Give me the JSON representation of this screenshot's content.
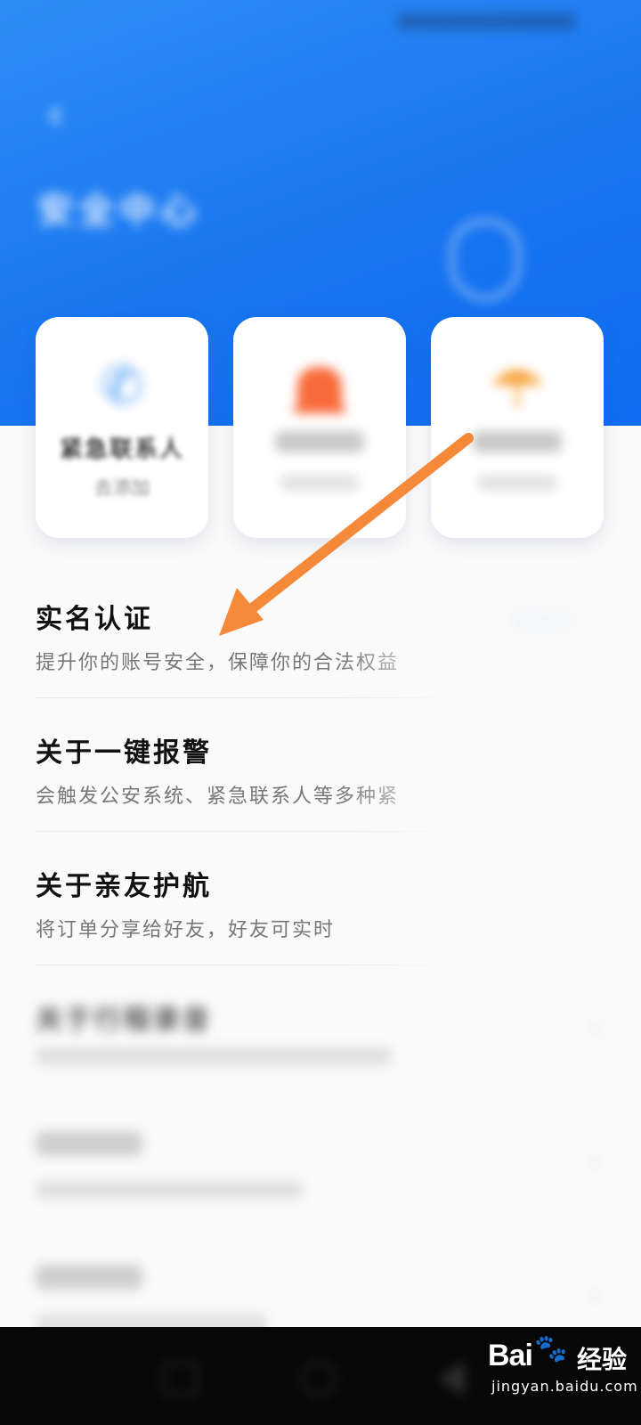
{
  "app": {
    "header": {
      "title": "安全中心",
      "subtitle": ""
    },
    "colors": {
      "header_blue": "#1976f0",
      "arrow_orange": "#f5893a",
      "card_bg": "#ffffff"
    },
    "quick_cards": [
      {
        "title": "紧急联系人",
        "subtitle": "去添加",
        "icon": "phone-icon"
      },
      {
        "title": "",
        "subtitle": "",
        "icon": "alarm-icon"
      },
      {
        "title": "",
        "subtitle": "",
        "icon": "umbrella-icon"
      }
    ],
    "list": [
      {
        "title": "实名认证",
        "desc": "提升你的账号安全，保障你的合法权益"
      },
      {
        "title": "关于一键报警",
        "desc": "会触发公安系统、紧急联系人等多种紧"
      },
      {
        "title": "关于亲友护航",
        "desc": "将订单分享给好友，好友可实时"
      },
      {
        "title": "关于行程录音",
        "desc": ""
      },
      {
        "title": "",
        "desc": ""
      },
      {
        "title": "",
        "desc": ""
      }
    ],
    "watermark": {
      "logo": "Bai",
      "paw": "🐾",
      "cn": "经验",
      "url": "jingyan.baidu.com"
    }
  }
}
